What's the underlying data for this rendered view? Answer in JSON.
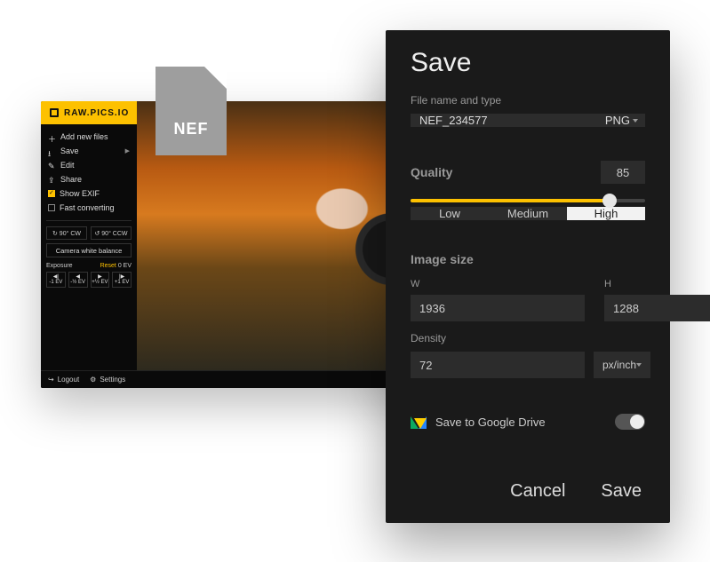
{
  "file_badge": {
    "ext": "NEF"
  },
  "brand": {
    "name": "RAW.PICS.IO"
  },
  "sidebar": {
    "items": {
      "add": {
        "label": "Add new files"
      },
      "save": {
        "label": "Save"
      },
      "edit": {
        "label": "Edit"
      },
      "share": {
        "label": "Share"
      },
      "exif": {
        "label": "Show EXIF",
        "checked": true
      },
      "fast": {
        "label": "Fast converting",
        "checked": false
      }
    },
    "rotate_cw": "↻ 90° CW",
    "rotate_ccw": "↺ 90° CCW",
    "wb_btn": "Camera white balance",
    "exposure": {
      "label": "Exposure",
      "reset": "Reset",
      "value": "0 EV",
      "steps": [
        "-1 EV",
        "-½ EV",
        "+½ EV",
        "+1 EV"
      ]
    }
  },
  "footer": {
    "logout": "Logout",
    "settings": "Settings"
  },
  "dialog": {
    "title": "Save",
    "file_label": "File name and type",
    "file_name": "NEF_234577",
    "file_type": "PNG",
    "quality_label": "Quality",
    "quality_value": "85",
    "seg": {
      "low": "Low",
      "medium": "Medium",
      "high": "High",
      "active": "high"
    },
    "image_size_label": "Image size",
    "w_label": "W",
    "h_label": "H",
    "width": "1936",
    "height": "1288",
    "density_label": "Density",
    "density": "72",
    "density_unit": "px/inch",
    "drive_label": "Save to Google Drive",
    "cancel": "Cancel",
    "save": "Save"
  }
}
